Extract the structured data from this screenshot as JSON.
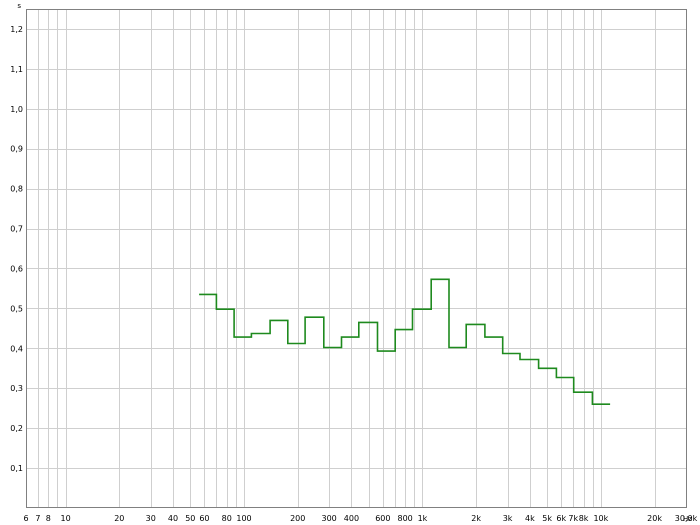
{
  "chart_data": {
    "type": "line",
    "style": "step",
    "title": "",
    "xlabel": "Hz",
    "ylabel": "s",
    "x_scale": "log",
    "xlim": [
      6,
      30000
    ],
    "ylim": [
      0,
      1.25
    ],
    "grid": true,
    "legend": "none",
    "colors": {
      "series": "#1e8a1e",
      "grid": "#cfcfcf",
      "axis": "#808080",
      "background": "#ffffff"
    },
    "x_ticks": [
      {
        "value": 6,
        "label": "6"
      },
      {
        "value": 7,
        "label": "7"
      },
      {
        "value": 8,
        "label": "8"
      },
      {
        "value": 10,
        "label": "10"
      },
      {
        "value": 20,
        "label": "20"
      },
      {
        "value": 30,
        "label": "30"
      },
      {
        "value": 40,
        "label": "40"
      },
      {
        "value": 50,
        "label": "50"
      },
      {
        "value": 60,
        "label": "60"
      },
      {
        "value": 80,
        "label": "80"
      },
      {
        "value": 100,
        "label": "100"
      },
      {
        "value": 200,
        "label": "200"
      },
      {
        "value": 300,
        "label": "300"
      },
      {
        "value": 400,
        "label": "400"
      },
      {
        "value": 600,
        "label": "600"
      },
      {
        "value": 800,
        "label": "800"
      },
      {
        "value": 1000,
        "label": "1k"
      },
      {
        "value": 2000,
        "label": "2k"
      },
      {
        "value": 3000,
        "label": "3k"
      },
      {
        "value": 4000,
        "label": "4k"
      },
      {
        "value": 5000,
        "label": "5k"
      },
      {
        "value": 6000,
        "label": "6k"
      },
      {
        "value": 7000,
        "label": "7k"
      },
      {
        "value": 8000,
        "label": "8k"
      },
      {
        "value": 10000,
        "label": "10k"
      },
      {
        "value": 20000,
        "label": "20k"
      },
      {
        "value": 30000,
        "label": "30,0k"
      }
    ],
    "x_grid": [
      6,
      7,
      8,
      9,
      10,
      20,
      30,
      40,
      50,
      60,
      70,
      80,
      90,
      100,
      200,
      300,
      400,
      500,
      600,
      700,
      800,
      900,
      1000,
      2000,
      3000,
      4000,
      5000,
      6000,
      7000,
      8000,
      9000,
      10000,
      20000,
      30000
    ],
    "y_ticks": [
      {
        "value": 0.1,
        "label": "0,1"
      },
      {
        "value": 0.2,
        "label": "0,2"
      },
      {
        "value": 0.3,
        "label": "0,3"
      },
      {
        "value": 0.4,
        "label": "0,4"
      },
      {
        "value": 0.5,
        "label": "0,5"
      },
      {
        "value": 0.6,
        "label": "0,6"
      },
      {
        "value": 0.7,
        "label": "0,7"
      },
      {
        "value": 0.8,
        "label": "0,8"
      },
      {
        "value": 0.9,
        "label": "0,9"
      },
      {
        "value": 1.0,
        "label": "1,0"
      },
      {
        "value": 1.1,
        "label": "1,1"
      },
      {
        "value": 1.2,
        "label": "1,2"
      }
    ],
    "series": [
      {
        "steps": [
          {
            "from": 56,
            "to": 70,
            "value": 0.535
          },
          {
            "from": 70,
            "to": 88,
            "value": 0.498
          },
          {
            "from": 88,
            "to": 110,
            "value": 0.428
          },
          {
            "from": 110,
            "to": 140,
            "value": 0.437
          },
          {
            "from": 140,
            "to": 176,
            "value": 0.47
          },
          {
            "from": 176,
            "to": 220,
            "value": 0.412
          },
          {
            "from": 220,
            "to": 280,
            "value": 0.478
          },
          {
            "from": 280,
            "to": 352,
            "value": 0.402
          },
          {
            "from": 352,
            "to": 440,
            "value": 0.428
          },
          {
            "from": 440,
            "to": 560,
            "value": 0.465
          },
          {
            "from": 560,
            "to": 704,
            "value": 0.393
          },
          {
            "from": 704,
            "to": 880,
            "value": 0.447
          },
          {
            "from": 880,
            "to": 1120,
            "value": 0.498
          },
          {
            "from": 1120,
            "to": 1408,
            "value": 0.573
          },
          {
            "from": 1408,
            "to": 1760,
            "value": 0.402
          },
          {
            "from": 1760,
            "to": 2240,
            "value": 0.46
          },
          {
            "from": 2240,
            "to": 2816,
            "value": 0.428
          },
          {
            "from": 2816,
            "to": 3520,
            "value": 0.387
          },
          {
            "from": 3520,
            "to": 4480,
            "value": 0.372
          },
          {
            "from": 4480,
            "to": 5632,
            "value": 0.35
          },
          {
            "from": 5632,
            "to": 7040,
            "value": 0.327
          },
          {
            "from": 7040,
            "to": 8960,
            "value": 0.29
          },
          {
            "from": 8960,
            "to": 11264,
            "value": 0.26
          }
        ]
      }
    ]
  }
}
